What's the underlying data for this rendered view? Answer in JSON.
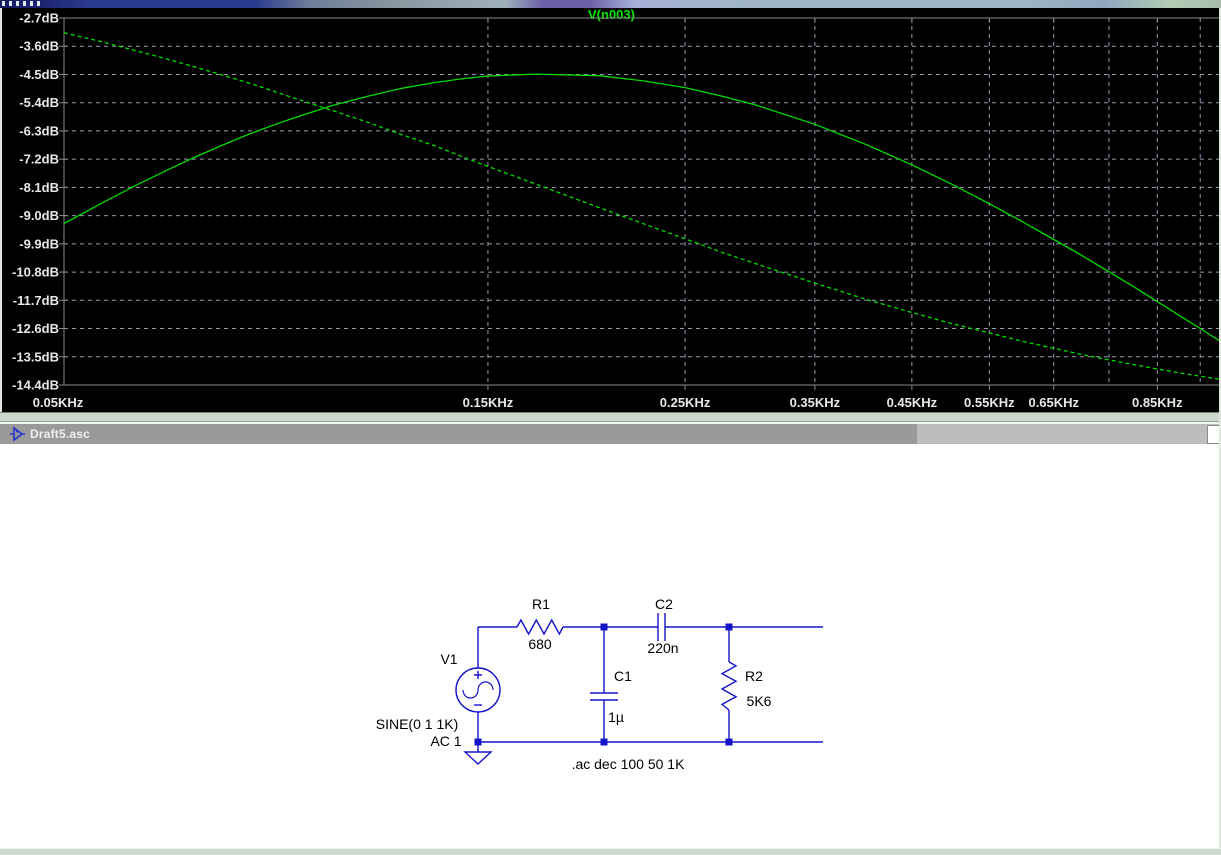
{
  "colors": {
    "plot_bg": "#000000",
    "trace_green": "#00dc00",
    "title_green": "#00e800",
    "grid": "#9a9ab2",
    "frame": "#8c8c8c",
    "axis_text": "#e8e8e8",
    "wire_blue": "#1414c8",
    "separator_green": "#ccd8cc",
    "titlebar_text": "#efefef"
  },
  "waveform_window": {
    "legend_title": "V(n003)"
  },
  "chart_data": {
    "type": "line",
    "title": "V(n003)",
    "legend_position": "top-center",
    "grid": true,
    "x_axis": {
      "scale": "log",
      "unit": "KHz",
      "range_khz": [
        0.05,
        1.0
      ],
      "tick_khz": [
        0.05,
        0.15,
        0.25,
        0.35,
        0.45,
        0.55,
        0.65,
        0.85
      ],
      "tick_labels": [
        "0.05KHz",
        "0.15KHz",
        "0.25KHz",
        "0.35KHz",
        "0.45KHz",
        "0.55KHz",
        "0.65KHz",
        "0.85KHz"
      ],
      "grid_khz": [
        0.15,
        0.25,
        0.35,
        0.45,
        0.55,
        0.65,
        0.75,
        0.85,
        0.95
      ]
    },
    "y_axis": {
      "unit": "dB",
      "range_db": [
        -14.4,
        -2.7
      ],
      "tick_step_db": 0.9,
      "tick_db": [
        -2.7,
        -3.6,
        -4.5,
        -5.4,
        -6.3,
        -7.2,
        -8.1,
        -9.0,
        -9.9,
        -10.8,
        -11.7,
        -12.6,
        -13.5,
        -14.4
      ],
      "tick_labels": [
        "-2.7dB",
        "-3.6dB",
        "-4.5dB",
        "-5.4dB",
        "-6.3dB",
        "-7.2dB",
        "-8.1dB",
        "-9.0dB",
        "-9.9dB",
        "-10.8dB",
        "-11.7dB",
        "-12.6dB",
        "-13.5dB",
        "-14.4dB"
      ]
    },
    "series": [
      {
        "name": "V(n003) magnitude (solid)",
        "line_style": "solid",
        "color": "#00dc00",
        "points_khz_db": [
          [
            0.05,
            -9.25
          ],
          [
            0.055,
            -8.62
          ],
          [
            0.06,
            -8.06
          ],
          [
            0.065,
            -7.58
          ],
          [
            0.07,
            -7.15
          ],
          [
            0.075,
            -6.78
          ],
          [
            0.08,
            -6.45
          ],
          [
            0.085,
            -6.17
          ],
          [
            0.09,
            -5.92
          ],
          [
            0.1,
            -5.5
          ],
          [
            0.11,
            -5.19
          ],
          [
            0.12,
            -4.94
          ],
          [
            0.13,
            -4.77
          ],
          [
            0.14,
            -4.64
          ],
          [
            0.15,
            -4.55
          ],
          [
            0.17,
            -4.49
          ],
          [
            0.2,
            -4.54
          ],
          [
            0.225,
            -4.71
          ],
          [
            0.25,
            -4.92
          ],
          [
            0.275,
            -5.19
          ],
          [
            0.3,
            -5.47
          ],
          [
            0.35,
            -6.09
          ],
          [
            0.4,
            -6.74
          ],
          [
            0.45,
            -7.38
          ],
          [
            0.5,
            -8.01
          ],
          [
            0.55,
            -8.62
          ],
          [
            0.6,
            -9.2
          ],
          [
            0.65,
            -9.76
          ],
          [
            0.7,
            -10.28
          ],
          [
            0.75,
            -10.79
          ],
          [
            0.8,
            -11.27
          ],
          [
            0.85,
            -11.74
          ],
          [
            0.9,
            -12.18
          ],
          [
            0.95,
            -12.6
          ],
          [
            1.0,
            -13.0
          ]
        ]
      },
      {
        "name": "V(n003) phase (dashed, right axis clipped)",
        "line_style": "dashed",
        "color": "#00dc00",
        "points_khz_db": [
          [
            0.05,
            -3.17
          ],
          [
            0.055,
            -3.45
          ],
          [
            0.06,
            -3.73
          ],
          [
            0.065,
            -3.99
          ],
          [
            0.07,
            -4.25
          ],
          [
            0.075,
            -4.5
          ],
          [
            0.08,
            -4.74
          ],
          [
            0.085,
            -4.98
          ],
          [
            0.09,
            -5.22
          ],
          [
            0.1,
            -5.64
          ],
          [
            0.11,
            -6.03
          ],
          [
            0.12,
            -6.42
          ],
          [
            0.13,
            -6.75
          ],
          [
            0.14,
            -7.11
          ],
          [
            0.15,
            -7.43
          ],
          [
            0.17,
            -8.0
          ],
          [
            0.2,
            -8.74
          ],
          [
            0.225,
            -9.27
          ],
          [
            0.25,
            -9.74
          ],
          [
            0.275,
            -10.17
          ],
          [
            0.3,
            -10.53
          ],
          [
            0.35,
            -11.15
          ],
          [
            0.4,
            -11.67
          ],
          [
            0.45,
            -12.09
          ],
          [
            0.5,
            -12.45
          ],
          [
            0.55,
            -12.74
          ],
          [
            0.6,
            -13.01
          ],
          [
            0.65,
            -13.23
          ],
          [
            0.7,
            -13.43
          ],
          [
            0.75,
            -13.6
          ],
          [
            0.8,
            -13.75
          ],
          [
            0.85,
            -13.89
          ],
          [
            0.9,
            -14.01
          ],
          [
            0.95,
            -14.12
          ],
          [
            1.0,
            -14.22
          ]
        ]
      }
    ]
  },
  "schematic_window": {
    "title": "Draft5.asc",
    "components": {
      "v1_name": "V1",
      "v1_sine": "SINE(0 1 1K)",
      "v1_ac": "AC 1",
      "r1_name": "R1",
      "r1_value": "680",
      "c1_name": "C1",
      "c1_value": "1µ",
      "c2_name": "C2",
      "c2_value": "220n",
      "r2_name": "R2",
      "r2_value": "5K6",
      "directive": ".ac dec 100 50 1K"
    }
  }
}
